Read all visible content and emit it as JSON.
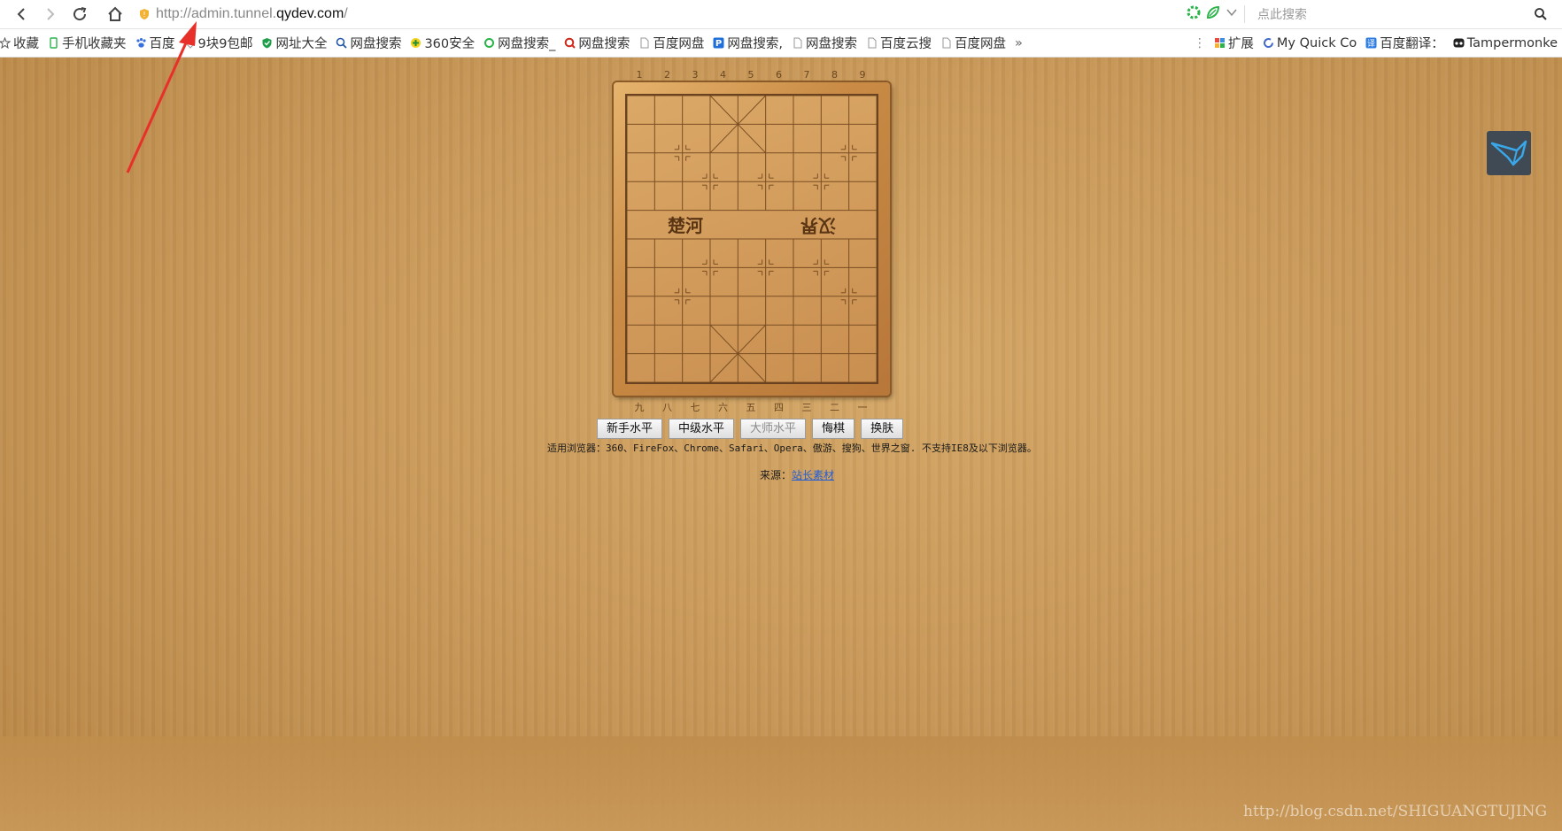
{
  "browser": {
    "url_prefix": "http://admin.tunnel.",
    "url_domain": "qydev.com",
    "url_suffix": "/",
    "search_placeholder": "点此搜索"
  },
  "bookmarks": [
    {
      "label": "收藏",
      "icon": "star-icon"
    },
    {
      "label": "手机收藏夹",
      "icon": "phone-icon"
    },
    {
      "label": "百度",
      "icon": "baidu-paw-icon"
    },
    {
      "label": "9块9包邮",
      "icon": "tag-icon"
    },
    {
      "label": "网址大全",
      "icon": "shield-check-icon"
    },
    {
      "label": "网盘搜索",
      "icon": "search-disc-icon"
    },
    {
      "label": "360安全",
      "icon": "360-icon"
    },
    {
      "label": "网盘搜索_",
      "icon": "ring-icon"
    },
    {
      "label": "网盘搜索",
      "icon": "q-icon"
    },
    {
      "label": "百度网盘",
      "icon": "page-icon"
    },
    {
      "label": "网盘搜索,",
      "icon": "p-icon"
    },
    {
      "label": "网盘搜索",
      "icon": "page-icon"
    },
    {
      "label": "百度云搜",
      "icon": "page-icon"
    },
    {
      "label": "百度网盘",
      "icon": "page-icon"
    }
  ],
  "bookmarks_more": "»",
  "bookmarks_right": [
    {
      "label": "扩展",
      "icon": "extension-grid-icon"
    },
    {
      "label": "My Quick Co",
      "icon": "refresh-logo-icon"
    },
    {
      "label": "百度翻译：",
      "icon": "translate-icon"
    },
    {
      "label": "Tampermonke",
      "icon": "tampermonkey-icon"
    }
  ],
  "board": {
    "top_numbers": [
      "1",
      "2",
      "3",
      "4",
      "5",
      "6",
      "7",
      "8",
      "9"
    ],
    "bottom_numbers": [
      "九",
      "八",
      "七",
      "六",
      "五",
      "四",
      "三",
      "二",
      "一"
    ],
    "river_left": "楚河",
    "river_right": "汉界"
  },
  "buttons": [
    {
      "label": "新手水平",
      "enabled": true
    },
    {
      "label": "中级水平",
      "enabled": true
    },
    {
      "label": "大师水平",
      "enabled": false
    },
    {
      "label": "悔棋",
      "enabled": true
    },
    {
      "label": "换肤",
      "enabled": true
    }
  ],
  "browsers_note": "适用浏览器：360、FireFox、Chrome、Safari、Opera、傲游、搜狗、世界之窗. 不支持IE8及以下浏览器。",
  "source_label": "来源：",
  "source_link": "站长素材",
  "watermark": "http://blog.csdn.net/SHIGUANGTUJING",
  "colors": {
    "page_bg": "#c89a5a",
    "annotation_arrow": "#e8302a",
    "link": "#1f5bd6"
  }
}
